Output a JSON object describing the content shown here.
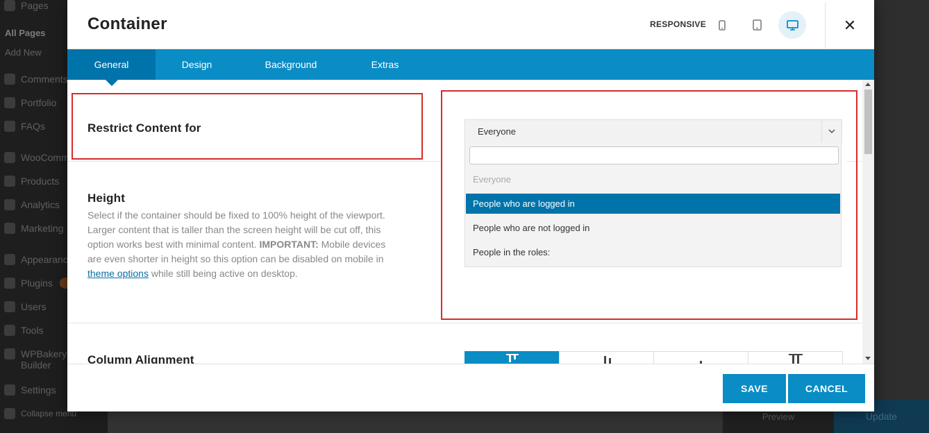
{
  "wp_sidebar": {
    "items": [
      {
        "label": "Pages",
        "icon": "pages-icon"
      },
      {
        "label": "All Pages",
        "sub": true,
        "current": true
      },
      {
        "label": "Add New",
        "sub": true
      },
      {
        "label": "Comments",
        "icon": "comments-icon"
      },
      {
        "label": "Portfolio",
        "icon": "portfolio-icon"
      },
      {
        "label": "FAQs",
        "icon": "faqs-icon"
      },
      {
        "label": "WooComm",
        "icon": "woocommerce-icon"
      },
      {
        "label": "Products",
        "icon": "products-icon"
      },
      {
        "label": "Analytics",
        "icon": "analytics-icon"
      },
      {
        "label": "Marketing",
        "icon": "marketing-icon"
      },
      {
        "label": "Appearance",
        "icon": "appearance-icon"
      },
      {
        "label": "Plugins",
        "icon": "plugins-icon",
        "badge": true
      },
      {
        "label": "Users",
        "icon": "users-icon"
      },
      {
        "label": "Tools",
        "icon": "tools-icon"
      },
      {
        "label": "WPBakery",
        "label2": "Builder",
        "icon": "wpbakery-icon"
      },
      {
        "label": "Settings",
        "icon": "settings-icon"
      },
      {
        "label": "Collapse menu",
        "icon": "collapse-icon"
      }
    ]
  },
  "wp_bottom": {
    "preview": "Preview",
    "update": "Update"
  },
  "modal": {
    "title": "Container",
    "responsive_label": "RESPONSIVE",
    "close_label": "✕",
    "tabs": [
      "General",
      "Design",
      "Background",
      "Extras"
    ],
    "active_tab": "General",
    "restrict": {
      "label": "Restrict Content for",
      "selected": "Everyone",
      "search_value": "",
      "options": [
        {
          "label": "Everyone",
          "state": "disabled"
        },
        {
          "label": "People who are logged in",
          "state": "highlighted"
        },
        {
          "label": "People who are not logged in",
          "state": "normal"
        },
        {
          "label": "People in the roles:",
          "state": "normal"
        }
      ]
    },
    "height": {
      "label": "Height",
      "desc_1": "Select if the container should be fixed to 100% height of the viewport. Larger content that is taller than the screen height will be cut off, this option works best with minimal content. ",
      "desc_important": "IMPORTANT:",
      "desc_2": " Mobile devices are even shorter in height so this option can be disabled on mobile in ",
      "desc_link": "theme options",
      "desc_3": " while still being active on desktop."
    },
    "column_alignment": {
      "label": "Column Alignment"
    },
    "footer": {
      "save": "SAVE",
      "cancel": "CANCEL"
    }
  },
  "colors": {
    "accent": "#0a8cc5",
    "accent_dark": "#0073aa",
    "highlight_box": "#d62b2b"
  }
}
